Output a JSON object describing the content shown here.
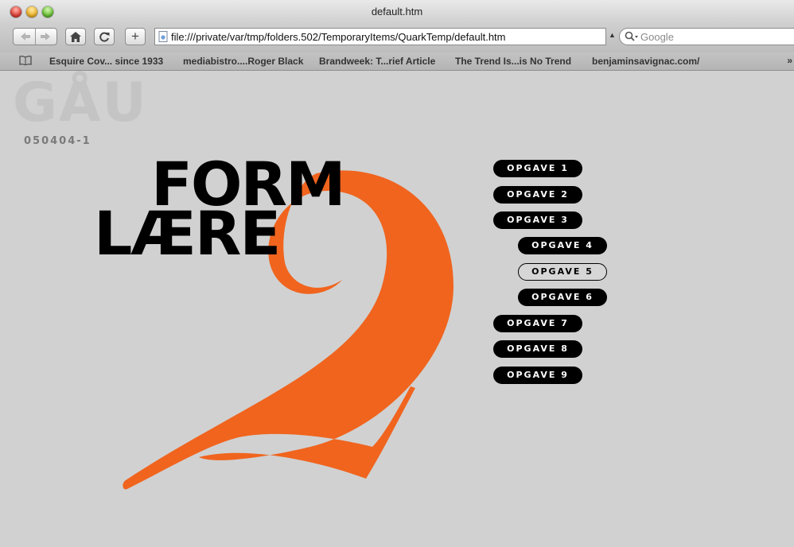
{
  "window": {
    "title": "default.htm"
  },
  "toolbar": {
    "url": "file:///private/var/tmp/folders.502/TemporaryItems/QuarkTemp/default.htm",
    "search_placeholder": "Google",
    "add_label": "+"
  },
  "bookmarks": [
    "Esquire Cov... since 1933",
    "mediabistro....Roger Black",
    "Brandweek: T...rief Article",
    "The Trend Is...is No Trend",
    "benjaminsavignac.com/"
  ],
  "bookmarks_more": "»",
  "page": {
    "logo": "GÅU",
    "code": "050404-1",
    "title_line1": "FORM",
    "title_line2": "LÆRE",
    "numeral": "2",
    "accent_color": "#f0641e",
    "menu": [
      {
        "label": "OPGAVE 1",
        "active": false
      },
      {
        "label": "OPGAVE 2",
        "active": false
      },
      {
        "label": "OPGAVE 3",
        "active": false
      },
      {
        "label": "OPGAVE 4",
        "active": false
      },
      {
        "label": "OPGAVE 5",
        "active": true
      },
      {
        "label": "OPGAVE 6",
        "active": false
      },
      {
        "label": "OPGAVE 7",
        "active": false
      },
      {
        "label": "OPGAVE 8",
        "active": false
      },
      {
        "label": "OPGAVE 9",
        "active": false
      }
    ]
  },
  "icons": {
    "back": "back-arrow-icon",
    "forward": "forward-arrow-icon",
    "home": "home-icon",
    "reload": "reload-icon",
    "bookmarks": "book-icon",
    "search": "magnifier-icon"
  }
}
